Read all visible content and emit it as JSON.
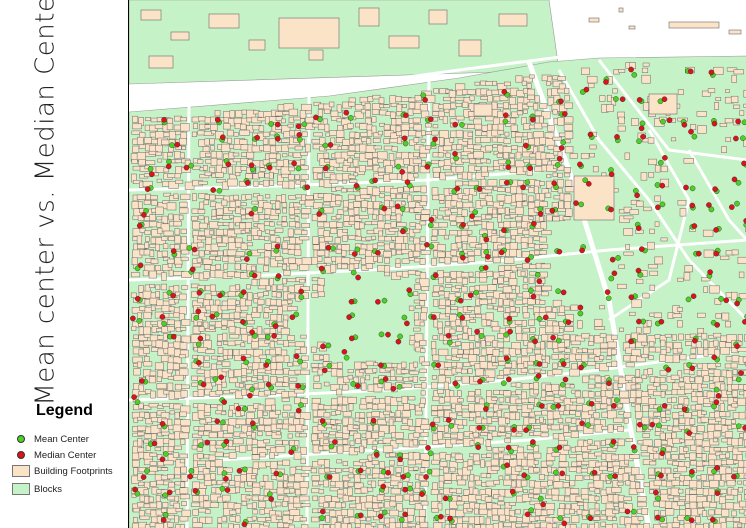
{
  "title": "Mean center vs. Median Center",
  "legend": {
    "heading": "Legend",
    "items": [
      {
        "label": "Mean Center",
        "symbol": "dot",
        "color": "#4cd224"
      },
      {
        "label": "Median Center",
        "symbol": "dot",
        "color": "#d9141a"
      },
      {
        "label": "Building Footprints",
        "symbol": "box",
        "color": "#fbe3c8"
      },
      {
        "label": "Blocks",
        "symbol": "box",
        "color": "#c5f2c6"
      }
    ]
  },
  "colors": {
    "blocks": "#c5f2c6",
    "buildings": "#fbe3c8",
    "building_outline": "#6b6b6b",
    "roads": "#ffffff",
    "mean_center": "#4cd224",
    "median_center": "#d9141a"
  }
}
